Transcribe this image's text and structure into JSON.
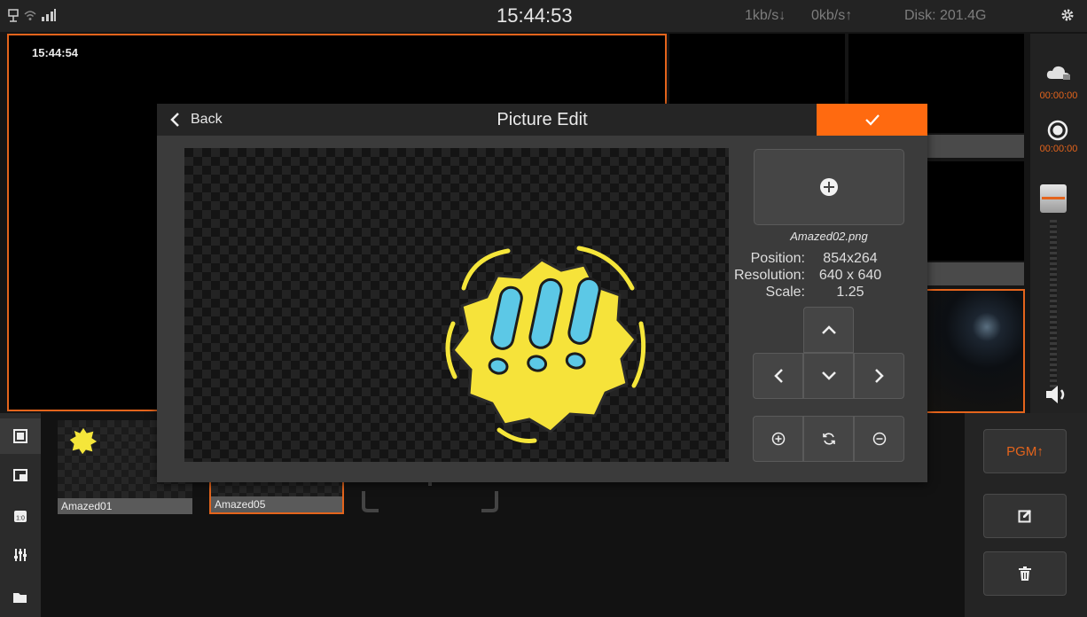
{
  "statusbar": {
    "clock": "15:44:53",
    "download_rate": "1kb/s↓",
    "upload_rate": "0kb/s↑",
    "disk": "Disk: 201.4G",
    "icons": [
      "network-icon",
      "wifi-icon",
      "signal-icon",
      "settings-gear-icon"
    ]
  },
  "monitor": {
    "timestamp": "15:44:54"
  },
  "rail": {
    "stream_time": "00:00:00",
    "record_time": "00:00:00",
    "icons": [
      "cloud-stream-icon",
      "record-icon",
      "volume-icon"
    ]
  },
  "dialog": {
    "back_label": "Back",
    "title": "Picture Edit",
    "file_name": "Amazed02.png",
    "position_label": "Position:",
    "position_value": "854x264",
    "resolution_label": "Resolution:",
    "resolution_value": "640 x 640",
    "scale_label": "Scale:",
    "scale_value": "1.25",
    "icons": [
      "chevron-left-icon",
      "check-icon",
      "add-circle-icon",
      "arrow-up-icon",
      "arrow-left-icon",
      "arrow-down-icon",
      "arrow-right-icon",
      "zoom-in-icon",
      "reset-icon",
      "zoom-out-icon"
    ]
  },
  "library": {
    "items": [
      {
        "label": "Amazed01"
      },
      {
        "label": "Amazed05"
      }
    ]
  },
  "leftbar": {
    "icons": [
      "picture-icon",
      "overlay-icon",
      "timer-icon",
      "mixer-icon",
      "folder-icon"
    ]
  },
  "rightpanel": {
    "pgm_label": "PGM↑",
    "icons": [
      "edit-icon",
      "trash-icon"
    ]
  },
  "colors": {
    "accent": "#ff6a10",
    "border_accent": "#e4641c"
  }
}
